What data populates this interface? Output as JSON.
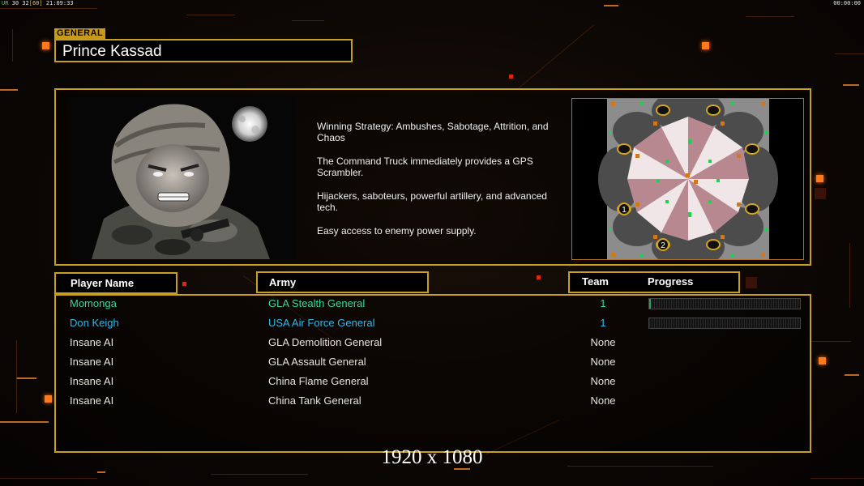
{
  "hud": {
    "fps_label": "UR",
    "fps": "30",
    "avg": "32",
    "cap": "[60]",
    "clock": "21:09:33",
    "timer": "00:00:00"
  },
  "general": {
    "tag": "GENERAL",
    "name": "Prince Kassad",
    "strategy": [
      "Winning Strategy: Ambushes, Sabotage, Attrition, and Chaos",
      "The Command Truck immediately provides a GPS Scrambler.",
      "Hijackers, saboteurs, powerful artillery, and advanced tech.",
      "Easy access to enemy power supply."
    ]
  },
  "map": {
    "start_positions": [
      "1",
      "2"
    ]
  },
  "columns": {
    "player_name": "Player Name",
    "army": "Army",
    "team": "Team",
    "progress": "Progress"
  },
  "players": [
    {
      "name": "Momonga",
      "army": "GLA Stealth General",
      "team": "1",
      "color": "#38d8a0",
      "progress": 0.01
    },
    {
      "name": "Don Keigh",
      "army": "USA Air Force General",
      "team": "1",
      "color": "#2fb8ea",
      "progress": 0
    },
    {
      "name": "Insane AI",
      "army": "GLA Demolition General",
      "team": "None",
      "color": "#e8e4dc"
    },
    {
      "name": "Insane AI",
      "army": "GLA Assault General",
      "team": "None",
      "color": "#e8e4dc"
    },
    {
      "name": "Insane AI",
      "army": "China Flame General",
      "team": "None",
      "color": "#e8e4dc"
    },
    {
      "name": "Insane AI",
      "army": "China Tank General",
      "team": "None",
      "color": "#e8e4dc"
    }
  ],
  "resolution": "1920 x 1080",
  "colors": {
    "accent": "#c8a020",
    "orange": "#ff7a1a"
  }
}
